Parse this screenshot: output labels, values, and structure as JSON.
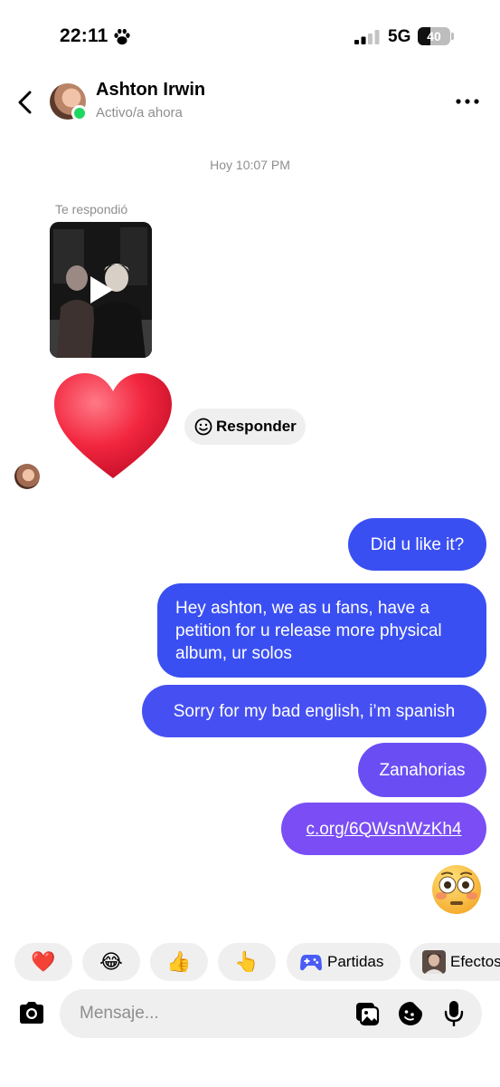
{
  "status_bar": {
    "time": "22:11",
    "network": "5G",
    "battery": "40",
    "battery_level": 0.4,
    "signal_bars": 2
  },
  "header": {
    "name": "Ashton Irwin",
    "status": "Activo/a ahora",
    "online_color": "#1ed760"
  },
  "conversation": {
    "timestamp": "Hoy 10:07 PM",
    "reply_label": "Te respondió",
    "reaction": "heart",
    "reply_button": "Responder",
    "sent_messages": [
      {
        "text": "Did u like it?"
      },
      {
        "text": "Hey ashton, we as u fans, have a petition for u release more physical album, ur solos"
      },
      {
        "text": "Sorry for my bad english, i’m spanish"
      },
      {
        "text": "Zanahorias"
      },
      {
        "text": "c.org/6QWsnWzKh4",
        "is_link": true
      }
    ],
    "last_emoji": "flushed-face"
  },
  "quick_replies": [
    {
      "emoji": "❤️"
    },
    {
      "emoji": "😂"
    },
    {
      "emoji": "👍"
    },
    {
      "emoji": "👆"
    },
    {
      "label": "Partidas",
      "icon": "gamepad-icon"
    },
    {
      "label": "Efectos",
      "icon": "effects-thumbnail"
    }
  ],
  "composer": {
    "placeholder": "Mensaje..."
  },
  "colors": {
    "bubble_blue": "#3a4ff2",
    "bubble_purple": "#7a4ef4",
    "muted_text": "#8e8e8e",
    "chip_bg": "#efefef"
  }
}
